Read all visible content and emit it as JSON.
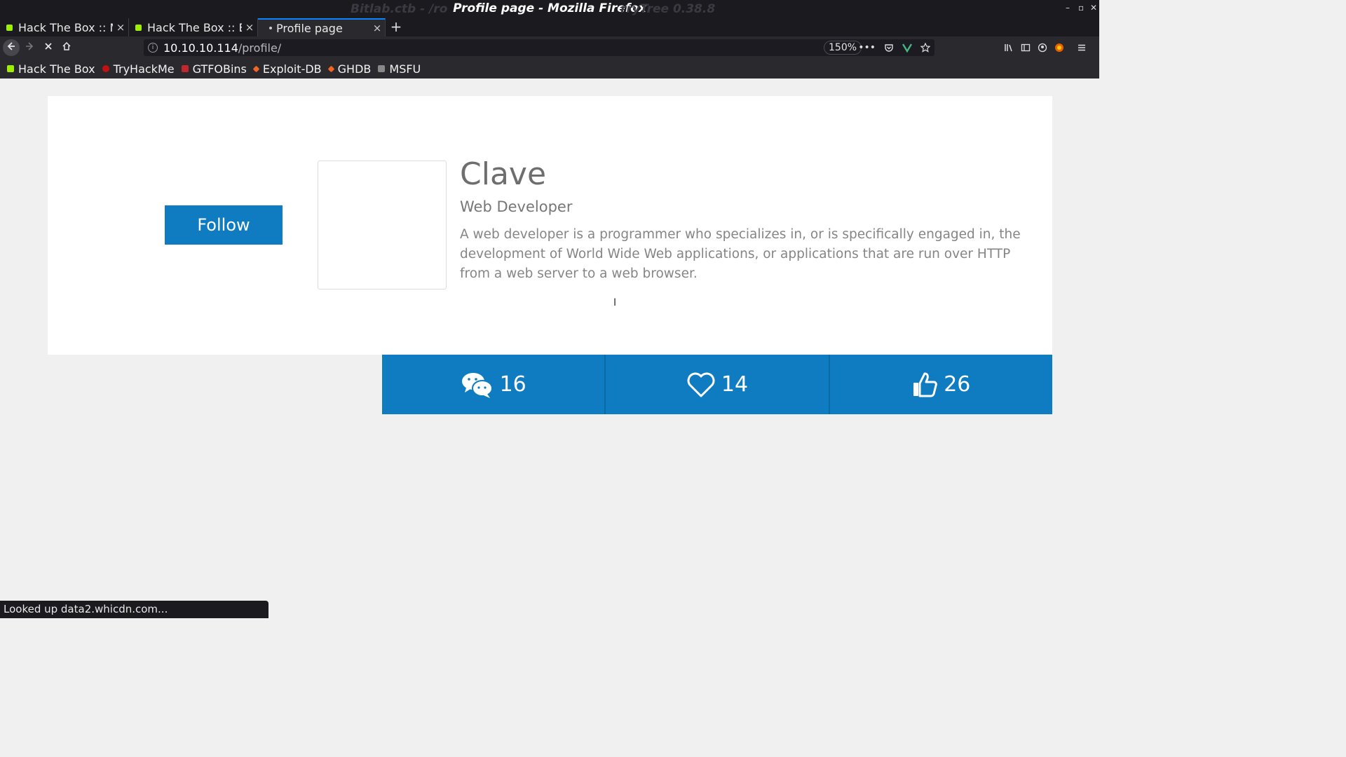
{
  "window": {
    "title": "Profile page - Mozilla Firefox",
    "ghost_left": "Bitlab.ctb - /ro",
    "ghost_right": "rryTree 0.38.8",
    "minimize": "–",
    "maximize": "▫",
    "close": "✕"
  },
  "tabs": [
    {
      "label": "Hack The Box :: M",
      "close": "×"
    },
    {
      "label": "Hack The Box :: E",
      "close": "×"
    },
    {
      "label": "Profile page",
      "close": "×"
    }
  ],
  "new_tab": "+",
  "nav": {
    "url_host": "10.10.10.114",
    "url_path": "/profile/",
    "zoom": "150%"
  },
  "bookmarks": [
    {
      "label": "Hack The Box",
      "color": "#9fef00"
    },
    {
      "label": "TryHackMe",
      "color": "#c11111"
    },
    {
      "label": "GTFOBins",
      "color": "#c1272d"
    },
    {
      "label": "Exploit-DB",
      "color": "#f26522"
    },
    {
      "label": "GHDB",
      "color": "#f26522"
    },
    {
      "label": "MSFU",
      "color": "#888888"
    }
  ],
  "profile": {
    "follow_label": "Follow",
    "name": "Clave",
    "role": "Web Developer",
    "bio": "A web developer is a programmer who specializes in, or is specifically engaged in, the development of World Wide Web applications, or applications that are run over HTTP from a web server to a web browser."
  },
  "stats": {
    "comments": "16",
    "likes": "14",
    "thumbs": "26"
  },
  "colors": {
    "accent": "#0f7cc1"
  },
  "status_bar": "Looked up data2.whicdn.com..."
}
